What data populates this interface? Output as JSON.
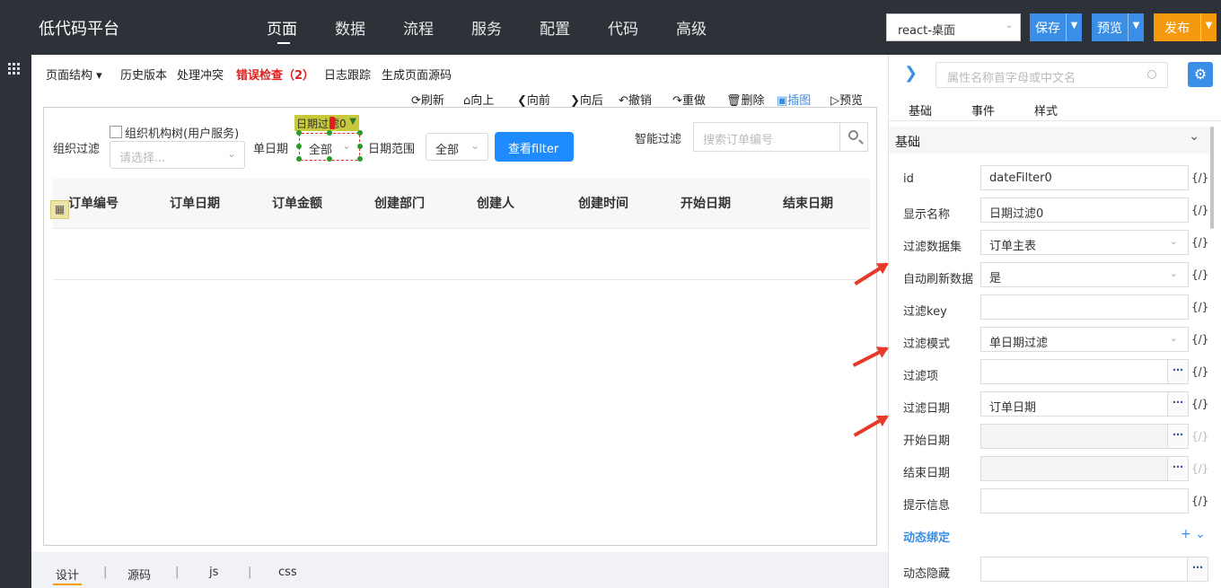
{
  "app": {
    "brand": "低代码平台",
    "nav": [
      "页面",
      "数据",
      "流程",
      "服务",
      "配置",
      "代码",
      "高级"
    ],
    "env": "react-桌面",
    "actions": {
      "save": "保存",
      "preview": "预览",
      "publish": "发布"
    }
  },
  "design_toolbar": {
    "items": [
      "页面结构",
      "历史版本",
      "处理冲突",
      "错误检查（2）",
      "日志跟踪",
      "生成页面源码"
    ],
    "page_struct_arrow": "▾",
    "tools": [
      "刷新",
      "向上",
      "向前",
      "向后",
      "撤销",
      "重做",
      "删除",
      "插图",
      "预览"
    ]
  },
  "canvas": {
    "org_filter_label": "组织过滤",
    "org_tree_label": "组织机构树(用户服务)",
    "org_placeholder": "请选择...",
    "single_date_label": "单日期",
    "selected_tag": "日期过滤0",
    "single_date_value": "全部",
    "date_range_label": "日期范围",
    "date_range_value": "全部",
    "filter_button": "查看filter",
    "smart_filter_label": "智能过滤",
    "search_placeholder": "搜索订单编号",
    "columns": [
      "订单编号",
      "订单日期",
      "订单金额",
      "创建部门",
      "创建人",
      "创建时间",
      "开始日期",
      "结束日期"
    ]
  },
  "bottom_tabs": [
    "设计",
    "源码",
    "js",
    "css"
  ],
  "panel": {
    "search_placeholder": "属性名称首字母或中文名",
    "tabs": [
      "基础",
      "事件",
      "样式"
    ],
    "section": "基础",
    "code_token": "{/}",
    "props": [
      {
        "label": "id",
        "value": ""
      },
      {
        "label": "显示名称",
        "value": "日期过滤0"
      },
      {
        "label": "过滤数据集",
        "value": "订单主表"
      },
      {
        "label": "自动刷新数据",
        "value": "是"
      },
      {
        "label": "过滤key",
        "value": ""
      },
      {
        "label": "过滤模式",
        "value": "单日期过滤"
      },
      {
        "label": "过滤项",
        "value": ""
      },
      {
        "label": "过滤日期",
        "value": "订单日期"
      },
      {
        "label": "开始日期",
        "value": ""
      },
      {
        "label": "结束日期",
        "value": ""
      },
      {
        "label": "提示信息",
        "value": ""
      }
    ],
    "id_value": "dateFilter0",
    "dynamic_section": "动态绑定",
    "dynamic_hidden": "动态隐藏"
  },
  "colors": {
    "topbar": "#2d3138",
    "primary": "#3a8ee6",
    "publish": "#f59a0c",
    "error": "#e02020"
  }
}
